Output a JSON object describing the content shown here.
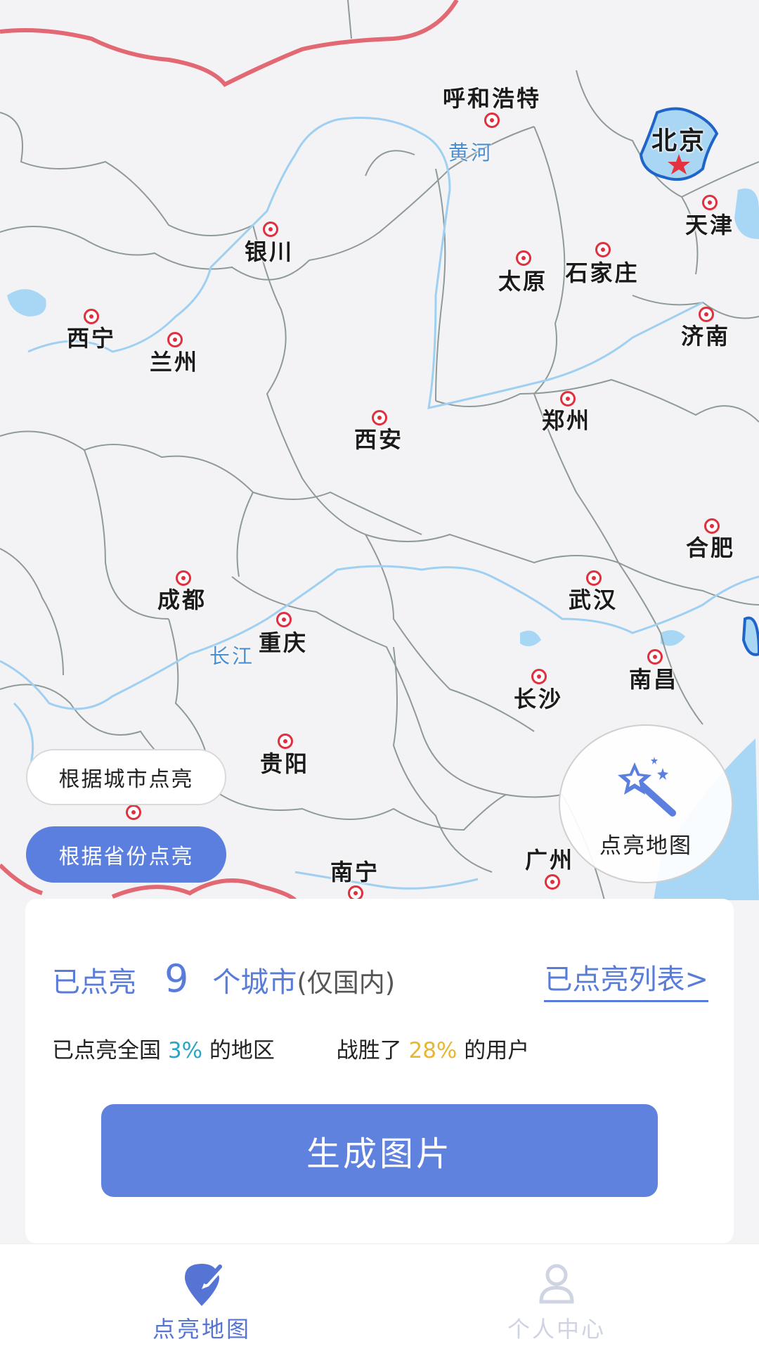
{
  "map": {
    "cities": [
      {
        "name": "呼和浩特"
      },
      {
        "name": "北京"
      },
      {
        "name": "天津"
      },
      {
        "name": "银川"
      },
      {
        "name": "太原"
      },
      {
        "name": "石家庄"
      },
      {
        "name": "西宁"
      },
      {
        "name": "兰州"
      },
      {
        "name": "济南"
      },
      {
        "name": "郑州"
      },
      {
        "name": "西安"
      },
      {
        "name": "合肥"
      },
      {
        "name": "成都"
      },
      {
        "name": "武汉"
      },
      {
        "name": "重庆"
      },
      {
        "name": "南昌"
      },
      {
        "name": "长沙"
      },
      {
        "name": "贵阳"
      },
      {
        "name": "南宁"
      },
      {
        "name": "广州"
      }
    ],
    "rivers": [
      {
        "name": "黄河"
      },
      {
        "name": "长江"
      }
    ],
    "colors": {
      "border": "#e26873",
      "river": "#9fd0f2",
      "water": "#a8d7f6",
      "province_line": "#8f9a98",
      "lit_fill": "#a9d6f2",
      "lit_stroke": "#1f64c8"
    }
  },
  "mode_buttons": {
    "by_city": "根据城市点亮",
    "by_province": "根据省份点亮"
  },
  "magic_button": {
    "label": "点亮地图",
    "icon": "magic-wand-icon"
  },
  "summary": {
    "prefix": "已点亮",
    "count": "9",
    "unit": "个城市",
    "note": "(仅国内)",
    "list_link": "已点亮列表>",
    "country_prefix": "已点亮全国",
    "country_pct": "3%",
    "country_suffix": "的地区",
    "beat_prefix": "战胜了",
    "beat_pct": "28%",
    "beat_suffix": "的用户"
  },
  "generate_button": "生成图片",
  "tabs": [
    {
      "label": "点亮地图",
      "icon": "map-pin-edit-icon",
      "active": true
    },
    {
      "label": "个人中心",
      "icon": "user-icon",
      "active": false
    }
  ]
}
